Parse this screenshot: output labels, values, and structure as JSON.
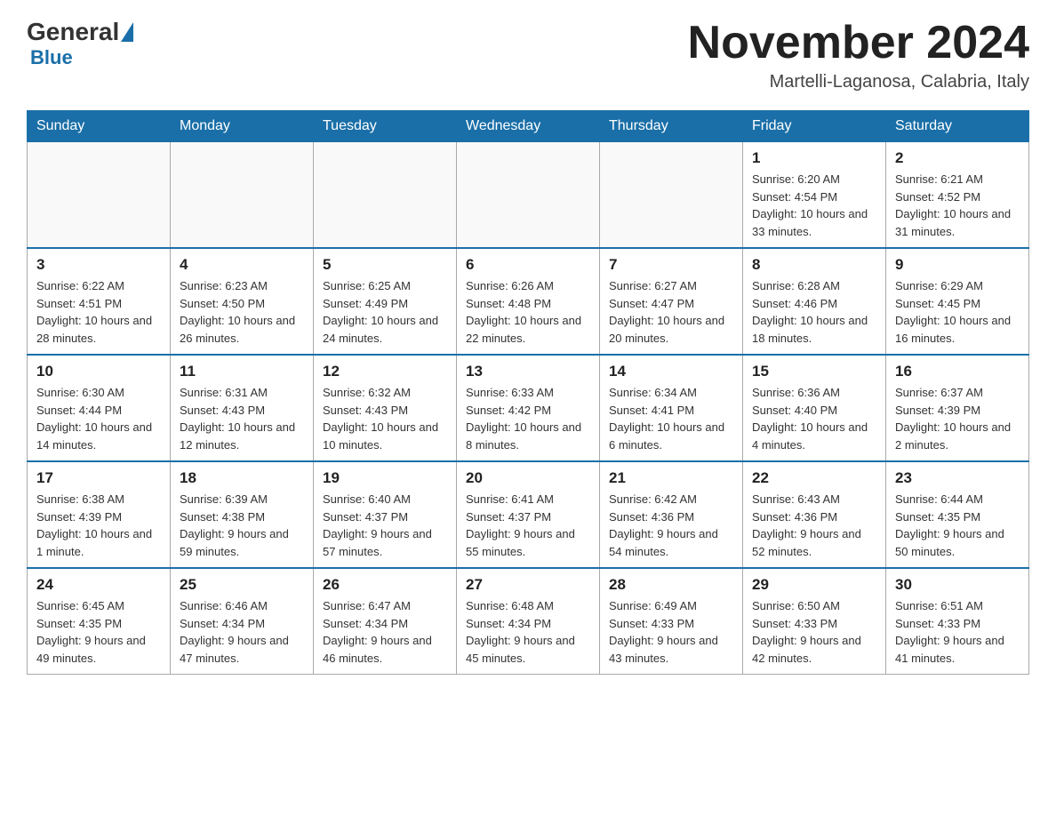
{
  "header": {
    "logo_general": "General",
    "logo_blue": "Blue",
    "month_title": "November 2024",
    "location": "Martelli-Laganosa, Calabria, Italy"
  },
  "days_of_week": [
    "Sunday",
    "Monday",
    "Tuesday",
    "Wednesday",
    "Thursday",
    "Friday",
    "Saturday"
  ],
  "weeks": [
    [
      {
        "day": "",
        "sunrise": "",
        "sunset": "",
        "daylight": ""
      },
      {
        "day": "",
        "sunrise": "",
        "sunset": "",
        "daylight": ""
      },
      {
        "day": "",
        "sunrise": "",
        "sunset": "",
        "daylight": ""
      },
      {
        "day": "",
        "sunrise": "",
        "sunset": "",
        "daylight": ""
      },
      {
        "day": "",
        "sunrise": "",
        "sunset": "",
        "daylight": ""
      },
      {
        "day": "1",
        "sunrise": "Sunrise: 6:20 AM",
        "sunset": "Sunset: 4:54 PM",
        "daylight": "Daylight: 10 hours and 33 minutes."
      },
      {
        "day": "2",
        "sunrise": "Sunrise: 6:21 AM",
        "sunset": "Sunset: 4:52 PM",
        "daylight": "Daylight: 10 hours and 31 minutes."
      }
    ],
    [
      {
        "day": "3",
        "sunrise": "Sunrise: 6:22 AM",
        "sunset": "Sunset: 4:51 PM",
        "daylight": "Daylight: 10 hours and 28 minutes."
      },
      {
        "day": "4",
        "sunrise": "Sunrise: 6:23 AM",
        "sunset": "Sunset: 4:50 PM",
        "daylight": "Daylight: 10 hours and 26 minutes."
      },
      {
        "day": "5",
        "sunrise": "Sunrise: 6:25 AM",
        "sunset": "Sunset: 4:49 PM",
        "daylight": "Daylight: 10 hours and 24 minutes."
      },
      {
        "day": "6",
        "sunrise": "Sunrise: 6:26 AM",
        "sunset": "Sunset: 4:48 PM",
        "daylight": "Daylight: 10 hours and 22 minutes."
      },
      {
        "day": "7",
        "sunrise": "Sunrise: 6:27 AM",
        "sunset": "Sunset: 4:47 PM",
        "daylight": "Daylight: 10 hours and 20 minutes."
      },
      {
        "day": "8",
        "sunrise": "Sunrise: 6:28 AM",
        "sunset": "Sunset: 4:46 PM",
        "daylight": "Daylight: 10 hours and 18 minutes."
      },
      {
        "day": "9",
        "sunrise": "Sunrise: 6:29 AM",
        "sunset": "Sunset: 4:45 PM",
        "daylight": "Daylight: 10 hours and 16 minutes."
      }
    ],
    [
      {
        "day": "10",
        "sunrise": "Sunrise: 6:30 AM",
        "sunset": "Sunset: 4:44 PM",
        "daylight": "Daylight: 10 hours and 14 minutes."
      },
      {
        "day": "11",
        "sunrise": "Sunrise: 6:31 AM",
        "sunset": "Sunset: 4:43 PM",
        "daylight": "Daylight: 10 hours and 12 minutes."
      },
      {
        "day": "12",
        "sunrise": "Sunrise: 6:32 AM",
        "sunset": "Sunset: 4:43 PM",
        "daylight": "Daylight: 10 hours and 10 minutes."
      },
      {
        "day": "13",
        "sunrise": "Sunrise: 6:33 AM",
        "sunset": "Sunset: 4:42 PM",
        "daylight": "Daylight: 10 hours and 8 minutes."
      },
      {
        "day": "14",
        "sunrise": "Sunrise: 6:34 AM",
        "sunset": "Sunset: 4:41 PM",
        "daylight": "Daylight: 10 hours and 6 minutes."
      },
      {
        "day": "15",
        "sunrise": "Sunrise: 6:36 AM",
        "sunset": "Sunset: 4:40 PM",
        "daylight": "Daylight: 10 hours and 4 minutes."
      },
      {
        "day": "16",
        "sunrise": "Sunrise: 6:37 AM",
        "sunset": "Sunset: 4:39 PM",
        "daylight": "Daylight: 10 hours and 2 minutes."
      }
    ],
    [
      {
        "day": "17",
        "sunrise": "Sunrise: 6:38 AM",
        "sunset": "Sunset: 4:39 PM",
        "daylight": "Daylight: 10 hours and 1 minute."
      },
      {
        "day": "18",
        "sunrise": "Sunrise: 6:39 AM",
        "sunset": "Sunset: 4:38 PM",
        "daylight": "Daylight: 9 hours and 59 minutes."
      },
      {
        "day": "19",
        "sunrise": "Sunrise: 6:40 AM",
        "sunset": "Sunset: 4:37 PM",
        "daylight": "Daylight: 9 hours and 57 minutes."
      },
      {
        "day": "20",
        "sunrise": "Sunrise: 6:41 AM",
        "sunset": "Sunset: 4:37 PM",
        "daylight": "Daylight: 9 hours and 55 minutes."
      },
      {
        "day": "21",
        "sunrise": "Sunrise: 6:42 AM",
        "sunset": "Sunset: 4:36 PM",
        "daylight": "Daylight: 9 hours and 54 minutes."
      },
      {
        "day": "22",
        "sunrise": "Sunrise: 6:43 AM",
        "sunset": "Sunset: 4:36 PM",
        "daylight": "Daylight: 9 hours and 52 minutes."
      },
      {
        "day": "23",
        "sunrise": "Sunrise: 6:44 AM",
        "sunset": "Sunset: 4:35 PM",
        "daylight": "Daylight: 9 hours and 50 minutes."
      }
    ],
    [
      {
        "day": "24",
        "sunrise": "Sunrise: 6:45 AM",
        "sunset": "Sunset: 4:35 PM",
        "daylight": "Daylight: 9 hours and 49 minutes."
      },
      {
        "day": "25",
        "sunrise": "Sunrise: 6:46 AM",
        "sunset": "Sunset: 4:34 PM",
        "daylight": "Daylight: 9 hours and 47 minutes."
      },
      {
        "day": "26",
        "sunrise": "Sunrise: 6:47 AM",
        "sunset": "Sunset: 4:34 PM",
        "daylight": "Daylight: 9 hours and 46 minutes."
      },
      {
        "day": "27",
        "sunrise": "Sunrise: 6:48 AM",
        "sunset": "Sunset: 4:34 PM",
        "daylight": "Daylight: 9 hours and 45 minutes."
      },
      {
        "day": "28",
        "sunrise": "Sunrise: 6:49 AM",
        "sunset": "Sunset: 4:33 PM",
        "daylight": "Daylight: 9 hours and 43 minutes."
      },
      {
        "day": "29",
        "sunrise": "Sunrise: 6:50 AM",
        "sunset": "Sunset: 4:33 PM",
        "daylight": "Daylight: 9 hours and 42 minutes."
      },
      {
        "day": "30",
        "sunrise": "Sunrise: 6:51 AM",
        "sunset": "Sunset: 4:33 PM",
        "daylight": "Daylight: 9 hours and 41 minutes."
      }
    ]
  ]
}
